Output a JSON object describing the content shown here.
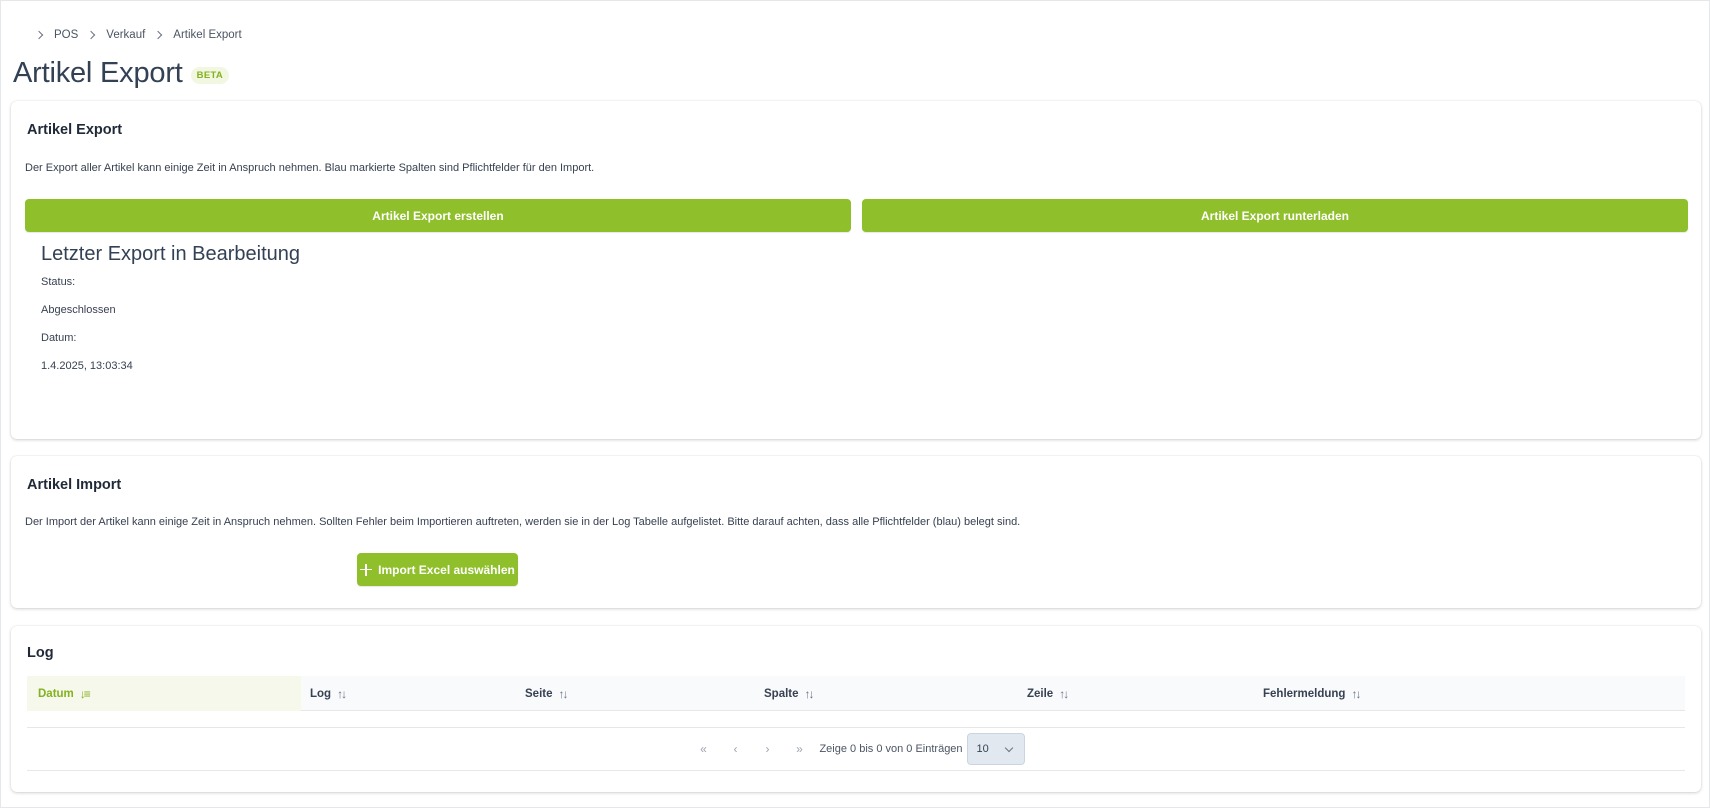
{
  "breadcrumb": [
    "POS",
    "Verkauf",
    "Artikel Export"
  ],
  "page": {
    "title": "Artikel Export",
    "badge": "BETA"
  },
  "export_card": {
    "title": "Artikel Export",
    "description": "Der Export aller Artikel kann einige Zeit in Anspruch nehmen. Blau markierte Spalten sind Pflichtfelder für den Import.",
    "create_button": "Artikel Export erstellen",
    "download_button": "Artikel Export runterladen",
    "last_export": {
      "heading": "Letzter Export in Bearbeitung",
      "status_label": "Status:",
      "status_value": "Abgeschlossen",
      "date_label": "Datum:",
      "date_value": "1.4.2025, 13:03:34"
    }
  },
  "import_card": {
    "title": "Artikel Import",
    "description": "Der Import der Artikel kann einige Zeit in Anspruch nehmen. Sollten Fehler beim Importieren auftreten, werden sie in der Log Tabelle aufgelistet. Bitte darauf achten, dass alle Pflichtfelder (blau) belegt sind.",
    "select_button": "Import Excel auswählen"
  },
  "log_card": {
    "title": "Log",
    "columns": [
      "Datum",
      "Log",
      "Seite",
      "Spalte",
      "Zeile",
      "Fehlermeldung"
    ],
    "rows": [],
    "pagination": {
      "info": "Zeige 0 bis 0 von 0 Einträgen",
      "page_size": "10"
    }
  },
  "colors": {
    "accent": "#8fbf2a",
    "accent_text": "#84b11f"
  }
}
